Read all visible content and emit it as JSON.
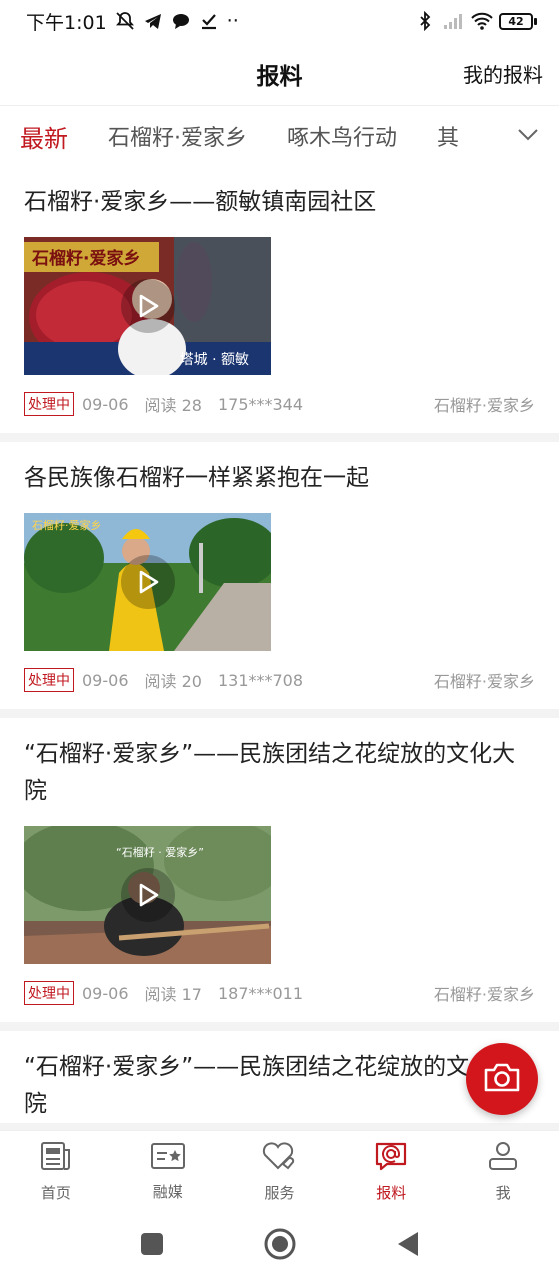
{
  "status_bar": {
    "time": "下午1:01",
    "dots": "··",
    "battery": "42"
  },
  "header": {
    "title": "报料",
    "my_reports": "我的报料"
  },
  "tabs": [
    {
      "label": "最新",
      "active": true
    },
    {
      "label": "石榴籽·爱家乡",
      "active": false
    },
    {
      "label": "啄木鸟行动",
      "active": false
    },
    {
      "label": "其",
      "active": false
    }
  ],
  "posts": [
    {
      "title": "石榴籽·爱家乡——额敏镇南园社区",
      "status": "处理中",
      "date": "09-06",
      "reads": "阅读 28",
      "user": "175***344",
      "category": "石榴籽·爱家乡",
      "thumb_caption": "石榴籽·爱家乡",
      "thumb_sub": "塔城 · 额敏"
    },
    {
      "title": "各民族像石榴籽一样紧紧抱在一起",
      "status": "处理中",
      "date": "09-06",
      "reads": "阅读 20",
      "user": "131***708",
      "category": "石榴籽·爱家乡",
      "thumb_caption": "石榴籽·爱家乡"
    },
    {
      "title": "“石榴籽·爱家乡”——民族团结之花绽放的文化大院",
      "status": "处理中",
      "date": "09-06",
      "reads": "阅读 17",
      "user": "187***011",
      "category": "石榴籽·爱家乡",
      "thumb_caption": "“石榴籽 · 爱家乡”"
    },
    {
      "title": "“石榴籽·爱家乡”——民族团结之花绽放的文化大院"
    }
  ],
  "bottom_nav": [
    {
      "label": "首页",
      "icon": "news-icon",
      "active": false
    },
    {
      "label": "融媒",
      "icon": "media-card-icon",
      "active": false
    },
    {
      "label": "服务",
      "icon": "heart-service-icon",
      "active": false
    },
    {
      "label": "报料",
      "icon": "report-chat-icon",
      "active": true
    },
    {
      "label": "我",
      "icon": "user-icon",
      "active": false
    }
  ],
  "colors": {
    "accent": "#c01920",
    "fab": "#d3151c"
  }
}
